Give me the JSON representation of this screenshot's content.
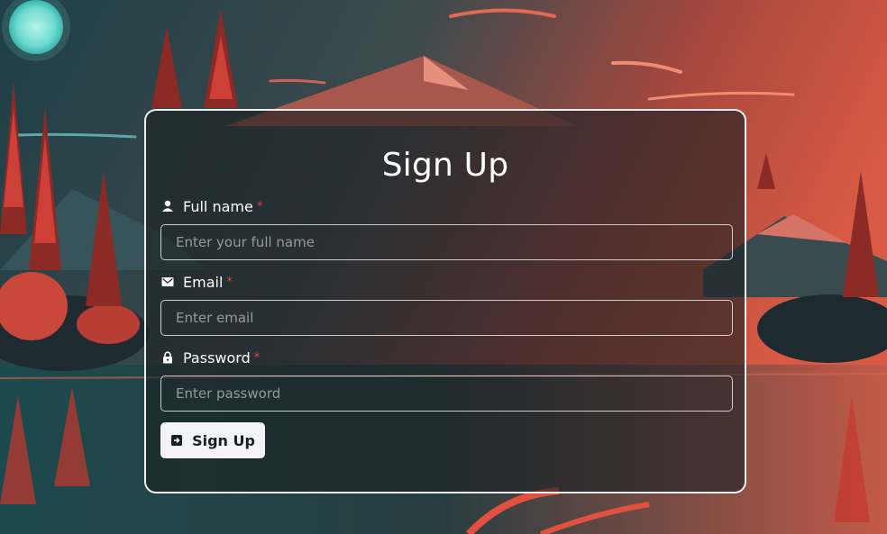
{
  "form": {
    "title": "Sign Up",
    "fields": [
      {
        "label": "Full name",
        "required_mark": "*",
        "placeholder": "Enter your full name",
        "value": "",
        "icon": "user-icon"
      },
      {
        "label": "Email",
        "required_mark": "*",
        "placeholder": "Enter email",
        "value": "",
        "icon": "mail-icon"
      },
      {
        "label": "Password",
        "required_mark": "*",
        "placeholder": "Enter password",
        "value": "",
        "icon": "lock-icon"
      }
    ],
    "submit_label": "Sign Up",
    "submit_icon": "sign-in-icon"
  },
  "colors": {
    "required": "#e53e3e",
    "button_bg": "#f2f4f8",
    "card_border": "#ffffff"
  }
}
